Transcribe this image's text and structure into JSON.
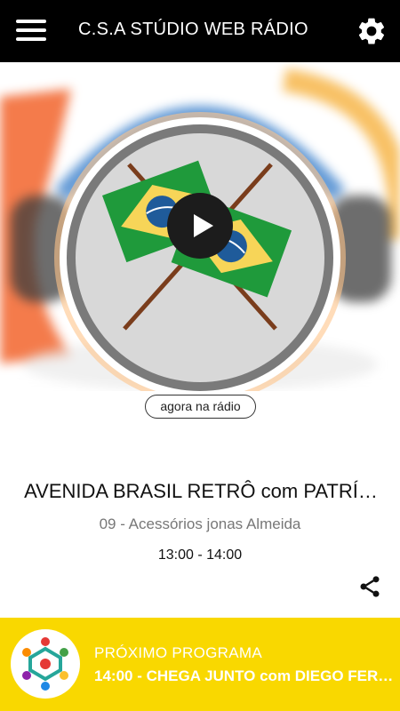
{
  "header": {
    "title": "C.S.A STÚDIO WEB RÁDIO",
    "menu_icon": "hamburger-menu-icon",
    "settings_icon": "gear-icon"
  },
  "hero": {
    "artwork": "brazil-flags-headphones-artwork",
    "play_icon": "play-icon"
  },
  "now_playing": {
    "badge": "agora na rádio",
    "program_title": "AVENIDA BRASIL RETRÔ com PATRÍ…",
    "subtitle": "09 - Acessórios jonas Almeida",
    "time": "13:00 - 14:00",
    "share_icon": "share-icon"
  },
  "next_program": {
    "label": "PRÓXIMO PROGRAMA",
    "title": "14:00 - CHEGA JUNTO com DIEGO FERR…",
    "logo_icon": "station-logo-icon"
  },
  "colors": {
    "topbar": "#000000",
    "accent_yellow": "#f9d800",
    "flag_green": "#1f9a3b",
    "flag_yellow": "#f7d558",
    "flag_blue": "#1f5b9a"
  }
}
